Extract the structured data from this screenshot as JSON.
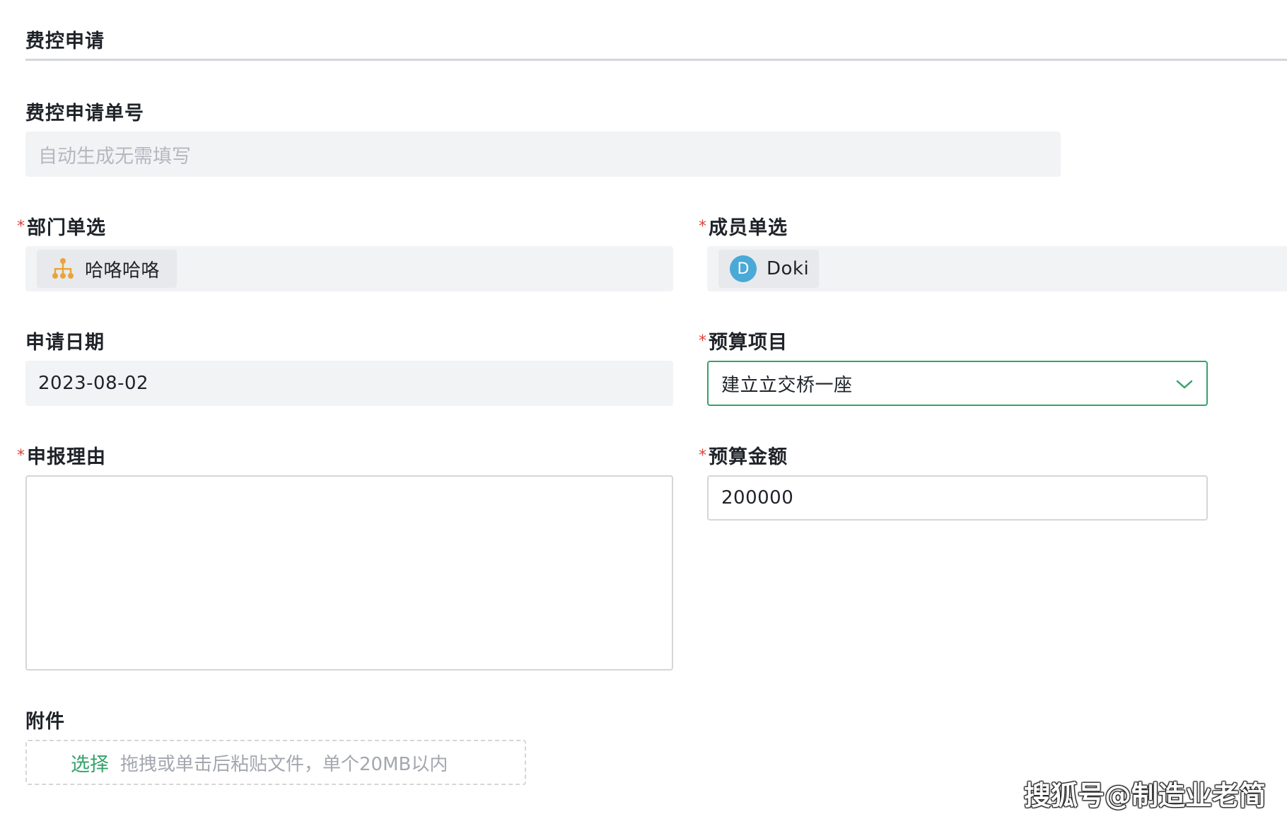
{
  "form": {
    "section_title": "费控申请",
    "required_mark": "*",
    "application_no": {
      "label": "费控申请单号",
      "placeholder": "自动生成无需填写"
    },
    "department": {
      "label": "部门单选",
      "value": "哈咯哈咯",
      "icon": "org-chart-icon"
    },
    "member": {
      "label": "成员单选",
      "value": "Doki",
      "avatar_initial": "D",
      "avatar_color": "#4aa9d6"
    },
    "apply_date": {
      "label": "申请日期",
      "value": "2023-08-02"
    },
    "budget_item": {
      "label": "预算项目",
      "value": "建立立交桥一座",
      "icon": "chevron-down-icon"
    },
    "reason": {
      "label": "申报理由",
      "value": ""
    },
    "budget_amount": {
      "label": "预算金额",
      "value": "200000"
    },
    "attachment": {
      "label": "附件",
      "select_label": "选择",
      "hint": "拖拽或单击后粘贴文件，单个20MB以内"
    }
  },
  "watermark": "搜狐号@制造业老简",
  "colors": {
    "accent_green": "#35a26b",
    "required_red": "#e0413a",
    "org_icon": "#e8a43a",
    "avatar_blue": "#4aa9d6"
  }
}
